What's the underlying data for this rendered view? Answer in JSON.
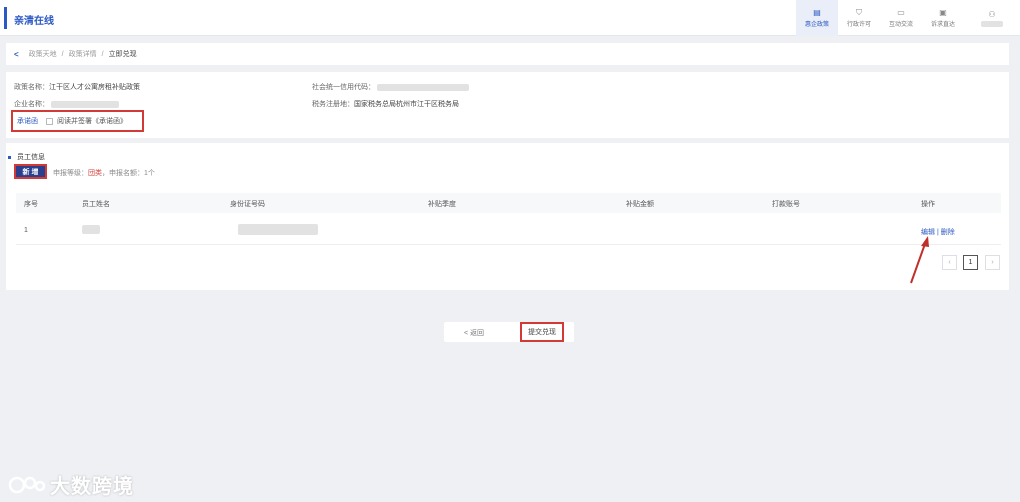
{
  "app": {
    "brand": "亲清在线"
  },
  "nav": [
    {
      "icon": "document-icon",
      "label": "惠企政策"
    },
    {
      "icon": "shield-check-icon",
      "label": "行政许可"
    },
    {
      "icon": "folder-icon",
      "label": "互动交流"
    },
    {
      "icon": "message-icon",
      "label": "诉求直达"
    }
  ],
  "breadcrumb": {
    "back": "<",
    "items": [
      "政策天地",
      "政策详情",
      "立即兑现"
    ],
    "separator": "/"
  },
  "info": {
    "policy_label": "政策名称：",
    "policy_value": "江干区人才公寓房租补贴政策",
    "company_label": "企业名称：",
    "credit_code_label": "社会统一信用代码：",
    "tax_label": "税务注册地：",
    "tax_value": "国家税务总局杭州市江干区税务局",
    "promise_label": "承诺函",
    "promise_check": "阅读并签署《承诺函》"
  },
  "staff": {
    "title": "员工信息",
    "add_button": "新 增",
    "hint_prefix": "申报等级：",
    "hint_level": "団类",
    "hint_suffix": "，申报名额：1个",
    "columns": [
      "序号",
      "员工姓名",
      "身份证号码",
      "补贴季度",
      "补贴金额",
      "打款账号",
      "操作"
    ],
    "rows": [
      {
        "index": "1",
        "edit": "编辑",
        "divider": "|",
        "delete": "删除"
      }
    ],
    "pagination": {
      "prev": "‹",
      "current": "1",
      "next": "›"
    }
  },
  "actions": {
    "back": "< 返回",
    "submit": "提交兑现"
  },
  "watermark": {
    "text": "大数跨境"
  },
  "colors": {
    "accent": "#2b59c3",
    "highlight": "#d23b35",
    "button": "#2b3f8f"
  }
}
